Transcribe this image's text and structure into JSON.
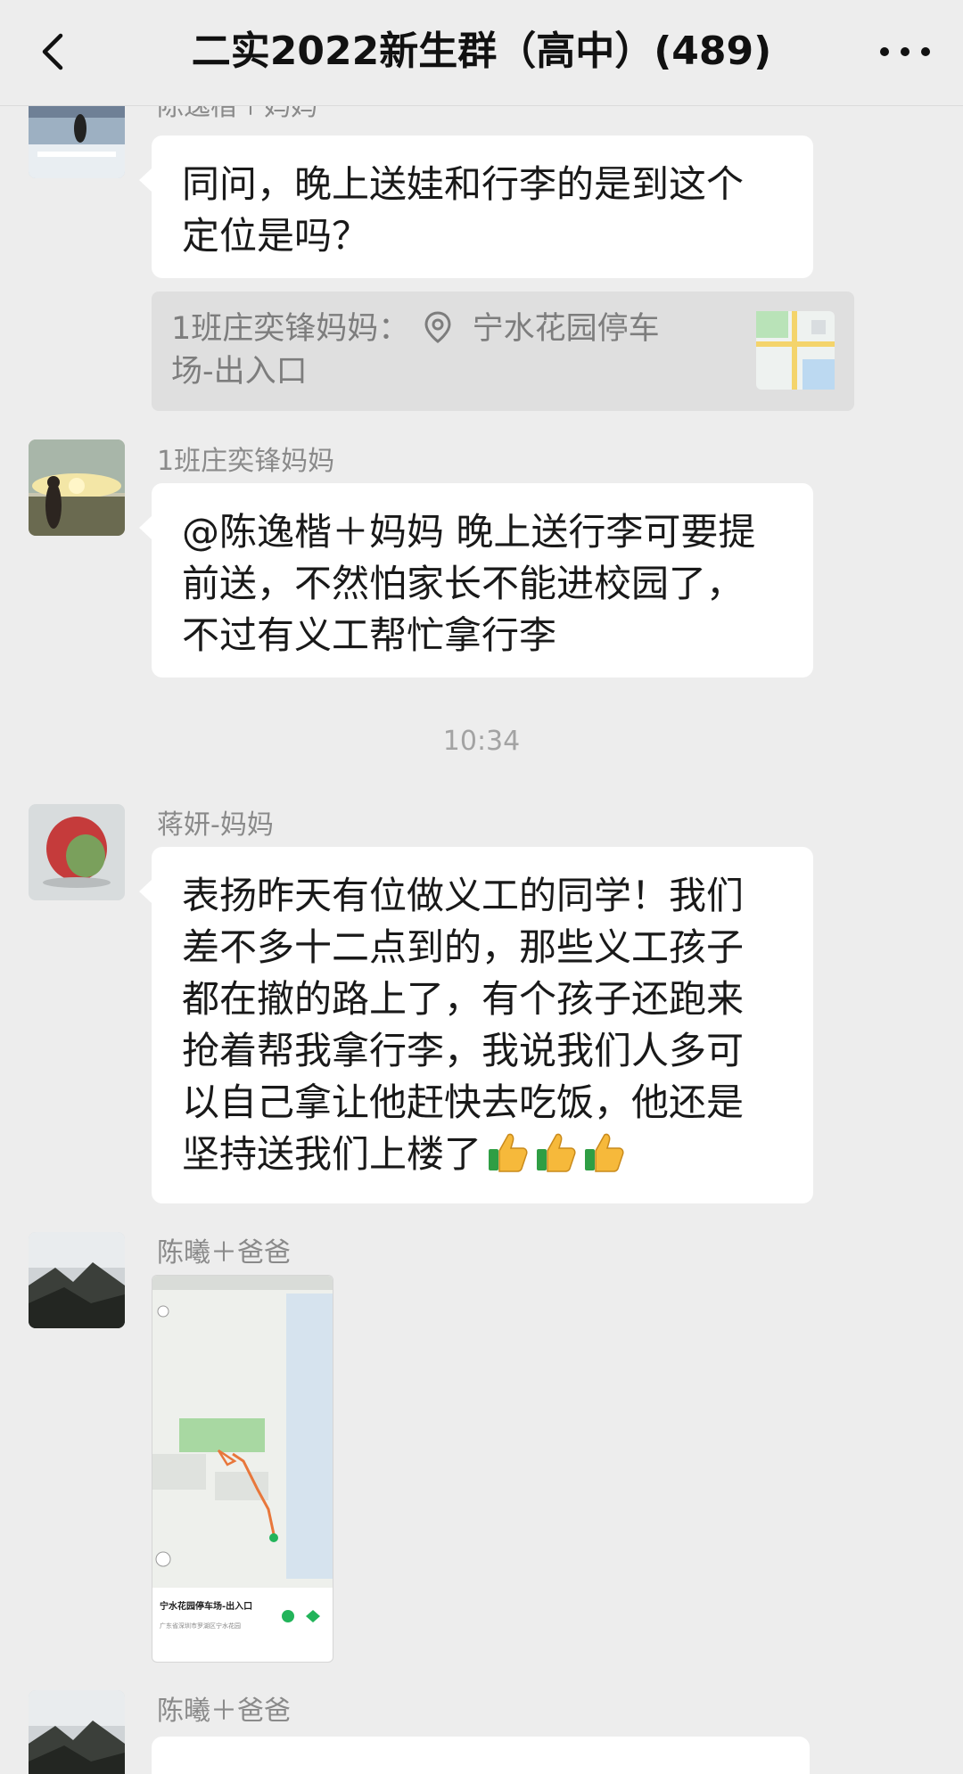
{
  "header": {
    "title": "二实2022新生群（高中）(489)"
  },
  "messages": [
    {
      "sender": "陈逸楷＋妈妈",
      "text_lines": [
        "同问，晚上送娃和行李的是到这个",
        "定位是吗？"
      ],
      "quote": {
        "author": "1班庄奕锋妈妈：",
        "location_lines": [
          "宁水花园停车",
          "场-出入口"
        ]
      }
    },
    {
      "sender": "1班庄奕锋妈妈",
      "text_lines": [
        "@陈逸楷＋妈妈  晚上送行李可要提",
        "前送，不然怕家长不能进校园了，",
        "不过有义工帮忙拿行李"
      ]
    },
    {
      "sender": "蒋妍-妈妈",
      "text_lines": [
        "表扬昨天有位做义工的同学！我们",
        "差不多十二点到的，那些义工孩子",
        "都在撤的路上了，有个孩子还跑来",
        "抢着帮我拿行李，我说我们人多可",
        "以自己拿让他赶快去吃饭，他还是",
        "坚持送我们上楼了"
      ]
    },
    {
      "sender": "陈曦＋爸爸",
      "map_card": {
        "caption": "宁水花园停车场-出入口",
        "address": "广东省深圳市罗湖区宁水花园"
      }
    },
    {
      "sender": "陈曦＋爸爸"
    }
  ],
  "time_divider": "10:34",
  "icons": {
    "back": "chevron-left-icon",
    "more": "more-dots-icon",
    "location": "location-pin-icon",
    "thumbs_up": "thumbs-up-icon"
  }
}
